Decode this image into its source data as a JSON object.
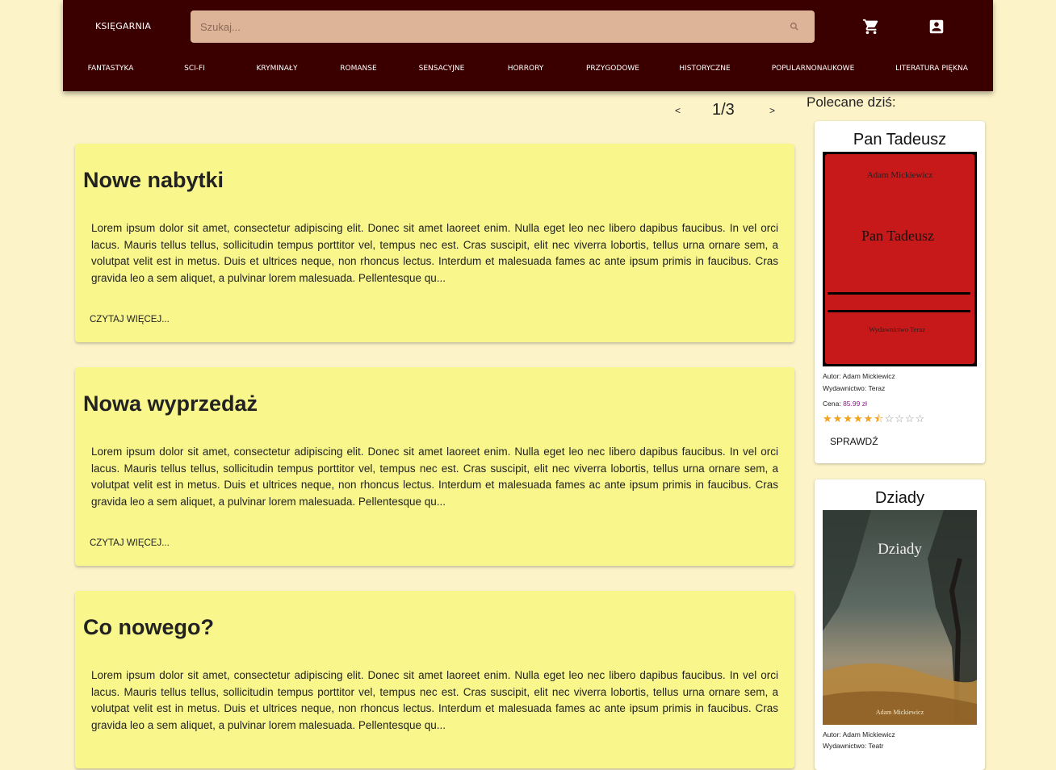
{
  "header": {
    "brand": "KSIĘGARNIA",
    "search_placeholder": "Szukaj...",
    "search_icon": "search-icon",
    "cart_icon": "cart-icon",
    "account_icon": "account-box-icon",
    "categories": [
      "FANTASTYKA",
      "SCI-FI",
      "KRYMINAŁY",
      "ROMANSE",
      "SENSACYJNE",
      "HORRORY",
      "PRZYGODOWE",
      "HISTORYCZNE",
      "POPULARNONAUKOWE",
      "LITERATURA PIĘKNA"
    ],
    "colors": {
      "bar": "#3a0000",
      "search": "#ddb497"
    }
  },
  "pager": {
    "prev": "<",
    "label": "1/3",
    "next": ">"
  },
  "articles": [
    {
      "title": "Nowe nabytki",
      "text": "Lorem ipsum dolor sit amet, consectetur adipiscing elit. Donec sit amet laoreet enim. Nulla eget leo nec libero dapibus faucibus. In vel orci lacus. Mauris tellus tellus, sollicitudin tempus porttitor vel, tempus nec est. Cras suscipit, elit nec viverra lobortis, tellus urna ornare sem, a volutpat velit est in metus. Duis et ultrices neque, non rhoncus lectus. Interdum et malesuada fames ac ante ipsum primis in faucibus. Cras gravida leo a sem aliquet, a pulvinar lorem malesuada. Pellentesque qu...",
      "more": "CZYTAJ WIĘCEJ..."
    },
    {
      "title": "Nowa wyprzedaż",
      "text": "Lorem ipsum dolor sit amet, consectetur adipiscing elit. Donec sit amet laoreet enim. Nulla eget leo nec libero dapibus faucibus. In vel orci lacus. Mauris tellus tellus, sollicitudin tempus porttitor vel, tempus nec est. Cras suscipit, elit nec viverra lobortis, tellus urna ornare sem, a volutpat velit est in metus. Duis et ultrices neque, non rhoncus lectus. Interdum et malesuada fames ac ante ipsum primis in faucibus. Cras gravida leo a sem aliquet, a pulvinar lorem malesuada. Pellentesque qu...",
      "more": "CZYTAJ WIĘCEJ..."
    },
    {
      "title": "Co nowego?",
      "text": "Lorem ipsum dolor sit amet, consectetur adipiscing elit. Donec sit amet laoreet enim. Nulla eget leo nec libero dapibus faucibus. In vel orci lacus. Mauris tellus tellus, sollicitudin tempus porttitor vel, tempus nec est. Cras suscipit, elit nec viverra lobortis, tellus urna ornare sem, a volutpat velit est in metus. Duis et ultrices neque, non rhoncus lectus. Interdum et malesuada fames ac ante ipsum primis in faucibus. Cras gravida leo a sem aliquet, a pulvinar lorem malesuada. Pellentesque qu...",
      "more": "CZYTAJ WIĘCEJ..."
    }
  ],
  "recommended": {
    "heading": "Polecane dziś:",
    "books": [
      {
        "title": "Pan Tadeusz",
        "cover_author": "Adam Mickiewicz",
        "cover_title": "Pan Tadeusz",
        "cover_publisher": "Wydawnictwo Teraz",
        "cover_color": "#c8191a",
        "author_label": "Autor:",
        "author": "Adam Mickiewicz",
        "publisher_label": "Wydawnictwo:",
        "publisher": "Teraz",
        "price_label": "Cena:",
        "price": "85.99 zł",
        "rating": 5.5,
        "rating_max": 10,
        "button": "SPRAWDŹ"
      },
      {
        "title": "Dziady",
        "cover_title": "Dziady",
        "cover_author": "Adam Mickiewicz",
        "author_label": "Autor:",
        "author": "Adam Mickiewicz",
        "publisher_label": "Wydawnictwo:",
        "publisher": "Teatr"
      }
    ]
  }
}
